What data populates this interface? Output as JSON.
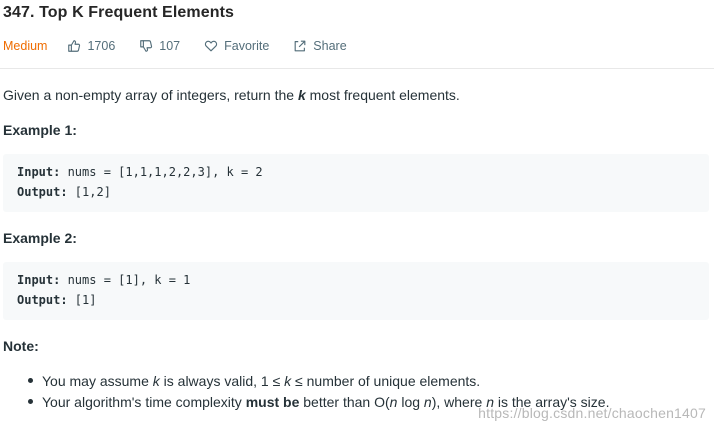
{
  "problem": {
    "title": "347. Top K Frequent Elements",
    "difficulty": "Medium",
    "likes": "1706",
    "dislikes": "107",
    "favorite_label": "Favorite",
    "share_label": "Share"
  },
  "description": {
    "before": "Given a non-empty array of integers, return the ",
    "emph": "k",
    "after": " most frequent elements."
  },
  "examples": [
    {
      "heading": "Example 1:",
      "input_label": "Input:",
      "input_value": " nums = [1,1,1,2,2,3], k = 2",
      "output_label": "Output:",
      "output_value": " [1,2]"
    },
    {
      "heading": "Example 2:",
      "input_label": "Input:",
      "input_value": " nums = [1], k = 1",
      "output_label": "Output:",
      "output_value": " [1]"
    }
  ],
  "note": {
    "heading": "Note:",
    "bullet1": {
      "a": "You may assume ",
      "k1": "k",
      "b": " is always valid, 1 ≤ ",
      "k2": "k",
      "c": " ≤ number of unique elements."
    },
    "bullet2": {
      "a": "Your algorithm's time complexity ",
      "strong": "must be",
      "b": " better than O(",
      "n1": "n",
      "c": " log ",
      "n2": "n",
      "d": "), where ",
      "n3": "n",
      "e": " is the array's size."
    }
  },
  "watermark": "https://blog.csdn.net/chaochen1407",
  "colors": {
    "difficulty": "#ef6c00",
    "code_bg": "#f7f9fa",
    "meta_text": "#546e7a"
  },
  "icons": [
    "thumbs-up-icon",
    "thumbs-down-icon",
    "heart-icon",
    "share-icon"
  ]
}
